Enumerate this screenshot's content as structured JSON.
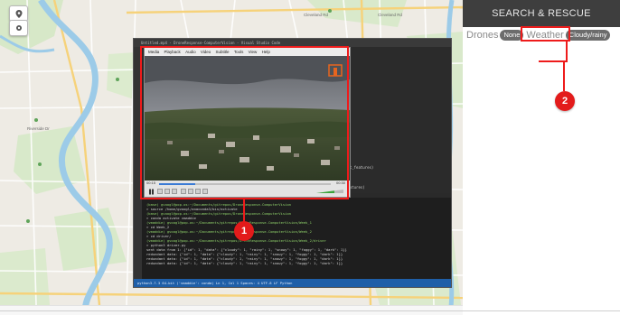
{
  "panel": {
    "title": "SEARCH & RESCUE",
    "drones_label": "Drones",
    "drones_value": "None",
    "weather_label": "Weather",
    "weather_value": "Cloudy/rainy"
  },
  "callouts": [
    {
      "number": "1",
      "target": "video-player"
    },
    {
      "number": "2",
      "target": "weather-status"
    }
  ],
  "map": {
    "labels": [
      "Cleveland Rd",
      "Cleveland Rd",
      "Riverside Dr"
    ],
    "controls": [
      "location-icon",
      "layers-icon"
    ]
  },
  "screen": {
    "title": "Untitled.mp4 - DroneResponse-ComputerVision - Visual Studio Code",
    "vlc_menu": [
      "Media",
      "Playback",
      "Audio",
      "Video",
      "Subtitle",
      "Tools",
      "View",
      "Help"
    ],
    "time_elapsed": "00:15",
    "time_total": "00:30",
    "editor_snippets": [
      "set_features)",
      "features)"
    ],
    "terminal_lines": [
      "(base) gvoogl@pop-os:~/Documents/gitrepos/DroneResponse-ComputerVision",
      "> source /home/gvoogl/anaconda3/bin/activate",
      "(base) gvoogl@pop-os:~/Documents/gitrepos/DroneResponse-ComputerVision",
      "> conda activate vmaddie",
      "(vmaddie) gvoogl@pop-os:~/Documents/gitrepos/DroneResponse-ComputerVision/Week_1",
      "> cd Week_2",
      "(vmaddie) gvoogl@pop-os:~/Documents/gitrepos/DroneResponse-ComputerVision/Week_2",
      "> cd driver/",
      "(vmaddie) gvoogl@pop-os:~/Documents/gitrepos/DroneResponse-ComputerVision/Week_2/driver",
      "> python3 driver.py",
      "sent data from 1: {\"id\": 1, \"data\": {\"cloudy\": 1, \"rainy\": 1, \"snowy\": 1, \"foggy\": 1, \"dark\": 1}}",
      "redundant data: {\"id\": 1, \"data\": {\"cloudy\": 1, \"rainy\": 1, \"snowy\": 1, \"foggy\": 1, \"dark\": 1}}",
      "redundant data: {\"id\": 1, \"data\": {\"cloudy\": 1, \"rainy\": 1, \"snowy\": 1, \"foggy\": 1, \"dark\": 1}}",
      "redundant data: {\"id\": 1, \"data\": {\"cloudy\": 1, \"rainy\": 1, \"snowy\": 1, \"foggy\": 1, \"dark\": 1}}"
    ],
    "status_bar": "python3.7.3 64-bit ('vmaddie': conda)   Ln 1, Col 1   Spaces: 4   UTF-8   LF   Python"
  }
}
